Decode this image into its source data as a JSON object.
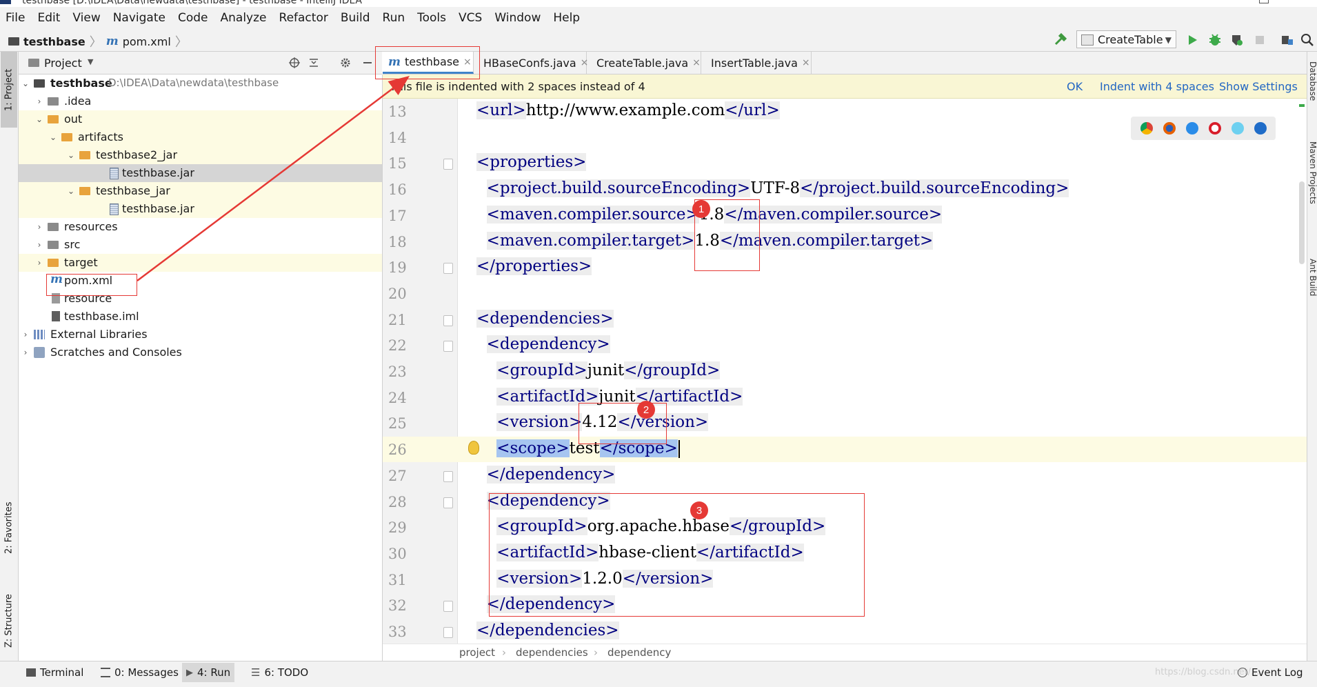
{
  "window": {
    "title": "testhbase [D:\\IDEA\\Data\\newdata\\testhbase] - testhbase - IntelliJ IDEA"
  },
  "menu": [
    "File",
    "Edit",
    "View",
    "Navigate",
    "Code",
    "Analyze",
    "Refactor",
    "Build",
    "Run",
    "Tools",
    "VCS",
    "Window",
    "Help"
  ],
  "navbar": {
    "project": "testhbase",
    "file": "pom.xml",
    "run_config": "CreateTable"
  },
  "left_tabs": {
    "project": "1: Project",
    "favorites": "2: Favorites",
    "structure": "Z: Structure"
  },
  "project_panel": {
    "header": "Project",
    "tree": [
      {
        "label": "testhbase",
        "path": "D:\\IDEA\\Data\\newdata\\testhbase",
        "icon": "folder-icon"
      },
      {
        "label": ".idea",
        "icon": "folder-icon"
      },
      {
        "label": "out",
        "icon": "folder-icon"
      },
      {
        "label": "artifacts",
        "icon": "folder-icon"
      },
      {
        "label": "testhbase2_jar",
        "icon": "folder-icon"
      },
      {
        "label": "testhbase.jar",
        "icon": "jar-icon"
      },
      {
        "label": "testhbase_jar",
        "icon": "folder-icon"
      },
      {
        "label": "testhbase.jar",
        "icon": "jar-icon"
      },
      {
        "label": "resources",
        "icon": "folder-icon"
      },
      {
        "label": "src",
        "icon": "folder-icon"
      },
      {
        "label": "target",
        "icon": "folder-icon"
      },
      {
        "label": "pom.xml",
        "icon": "maven-icon"
      },
      {
        "label": "resource",
        "icon": "file-icon"
      },
      {
        "label": "testhbase.iml",
        "icon": "iml-icon"
      },
      {
        "label": "External Libraries",
        "icon": "library-icon"
      },
      {
        "label": "Scratches and Consoles",
        "icon": "scratch-icon"
      }
    ]
  },
  "editor_tabs": [
    {
      "label": "testhbase",
      "active": true
    },
    {
      "label": "HBaseConfs.java"
    },
    {
      "label": "CreateTable.java"
    },
    {
      "label": "InsertTable.java"
    }
  ],
  "notification": {
    "message": "This file is indented with 2 spaces instead of 4",
    "ok": "OK",
    "indent": "Indent with 4 spaces",
    "settings": "Show Settings"
  },
  "code_lines": [
    {
      "n": "13",
      "code": "<url>http://www.example.com</url>"
    },
    {
      "n": "14",
      "code": ""
    },
    {
      "n": "15",
      "code": "<properties>"
    },
    {
      "n": "16",
      "code": "  <project.build.sourceEncoding>UTF-8</project.build.sourceEncoding>"
    },
    {
      "n": "17",
      "code": "  <maven.compiler.source>1.8</maven.compiler.source>"
    },
    {
      "n": "18",
      "code": "  <maven.compiler.target>1.8</maven.compiler.target>"
    },
    {
      "n": "19",
      "code": "</properties>"
    },
    {
      "n": "20",
      "code": ""
    },
    {
      "n": "21",
      "code": "<dependencies>"
    },
    {
      "n": "22",
      "code": "  <dependency>"
    },
    {
      "n": "23",
      "code": "    <groupId>junit</groupId>"
    },
    {
      "n": "24",
      "code": "    <artifactId>junit</artifactId>"
    },
    {
      "n": "25",
      "code": "    <version>4.12</version>"
    },
    {
      "n": "26",
      "code": "    <scope>test</scope>"
    },
    {
      "n": "27",
      "code": "  </dependency>"
    },
    {
      "n": "28",
      "code": "  <dependency>"
    },
    {
      "n": "29",
      "code": "    <groupId>org.apache.hbase</groupId>"
    },
    {
      "n": "30",
      "code": "    <artifactId>hbase-client</artifactId>"
    },
    {
      "n": "31",
      "code": "    <version>1.2.0</version>"
    },
    {
      "n": "32",
      "code": "  </dependency>"
    },
    {
      "n": "33",
      "code": "</dependencies>"
    }
  ],
  "breadcrumbs": [
    "project",
    "dependencies",
    "dependency"
  ],
  "right_tabs": {
    "database": "Database",
    "maven": "Maven Projects",
    "ant": "Ant Build"
  },
  "bottom_tabs": {
    "terminal": "Terminal",
    "messages": "0: Messages",
    "run": "4: Run",
    "todo": "6: TODO",
    "event_log": "Event Log"
  },
  "watermark": "https://blog.csdn.net/...",
  "annotations": {
    "badge1": "1",
    "badge2": "2",
    "badge3": "3"
  },
  "colors": {
    "annotation": "#e53935",
    "tag": "#000080",
    "link": "#2266c3",
    "selection": "#a6c5f0"
  }
}
